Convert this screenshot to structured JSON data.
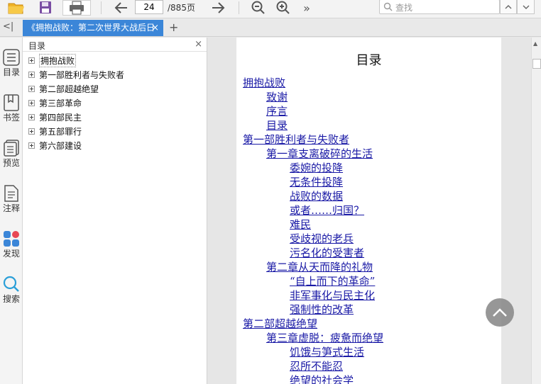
{
  "toolbar": {
    "page_current": "24",
    "page_total": "/885页",
    "search_placeholder": "查找",
    "more": "»"
  },
  "tabs": [
    {
      "label": "《拥抱战败：第二次世界大战后日",
      "close": "×"
    }
  ],
  "tabbar": {
    "collapse": "<|",
    "add": "+"
  },
  "sidebar": {
    "items": [
      {
        "label": "目录"
      },
      {
        "label": "书签"
      },
      {
        "label": "预览"
      },
      {
        "label": "注释"
      },
      {
        "label": "发现"
      },
      {
        "label": "搜索"
      }
    ]
  },
  "toc_panel": {
    "title": "目录",
    "close": "×",
    "items": [
      {
        "label": "拥抱战败"
      },
      {
        "label": "第一部胜利者与失败者"
      },
      {
        "label": "第二部超越绝望"
      },
      {
        "label": "第三部革命"
      },
      {
        "label": "第四部民主"
      },
      {
        "label": "第五部罪行"
      },
      {
        "label": "第六部建设"
      }
    ]
  },
  "document": {
    "heading": "目录",
    "entries": [
      {
        "text": "拥抱战败",
        "level": 1
      },
      {
        "text": "致谢",
        "level": 2
      },
      {
        "text": "序言",
        "level": 2
      },
      {
        "text": "目录",
        "level": 2
      },
      {
        "text": "第一部胜利者与失败者",
        "level": 1
      },
      {
        "text": "第一章支离破碎的生活",
        "level": 2
      },
      {
        "text": "委婉的投降",
        "level": 3
      },
      {
        "text": "无条件投降",
        "level": 3
      },
      {
        "text": "战败的数据",
        "level": 3
      },
      {
        "text": "或者……归国？",
        "level": 3
      },
      {
        "text": "难民",
        "level": 3
      },
      {
        "text": "受歧视的老兵",
        "level": 3
      },
      {
        "text": "污名化的受害者",
        "level": 3
      },
      {
        "text": "第二章从天而降的礼物",
        "level": 2
      },
      {
        "text": "“自上而下的革命”",
        "level": 3
      },
      {
        "text": "非军事化与民主化",
        "level": 3
      },
      {
        "text": "强制性的改革",
        "level": 3
      },
      {
        "text": "第二部超越绝望",
        "level": 1
      },
      {
        "text": "第三章虚脱：疲惫而绝望",
        "level": 2
      },
      {
        "text": "饥饿与笋式生活",
        "level": 3
      },
      {
        "text": "忍所不能忍",
        "level": 3
      },
      {
        "text": "绝望的社会学",
        "level": 3
      }
    ]
  },
  "colors": {
    "tab_active": "#3b86d8",
    "link": "#1a1aa6",
    "back_to_top": "#8c8c8c"
  }
}
